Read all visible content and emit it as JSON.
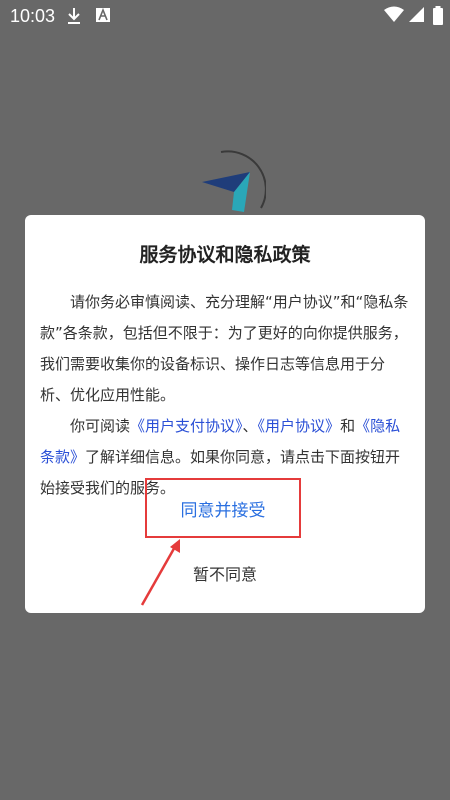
{
  "status_bar": {
    "time": "10:03",
    "icons": [
      "download-icon",
      "a-badge-icon",
      "wifi-icon",
      "signal-icon",
      "battery-icon"
    ]
  },
  "dialog": {
    "title": "服务协议和隐私政策",
    "para1": "请你务必审慎阅读、充分理解“用户协议”和“隐私条款”各条款，包括但不限于：为了更好的向你提供服务，我们需要收集你的设备标识、操作日志等信息用于分析、优化应用性能。",
    "para2_prefix": "你可阅读",
    "link_payment": "《用户支付协议》",
    "sep": "、",
    "link_user": "《用户协议》",
    "and": "和",
    "link_privacy": "《隐私条款》",
    "para2_suffix": "了解详细信息。如果你同意，请点击下面按钮开始接受我们的服务。",
    "agree_label": "同意并接受",
    "decline_label": "暂不同意"
  },
  "colors": {
    "link": "#2a4fd6",
    "agree": "#2a6fe0",
    "highlight": "#e53b3b",
    "backdrop": "#686868"
  }
}
